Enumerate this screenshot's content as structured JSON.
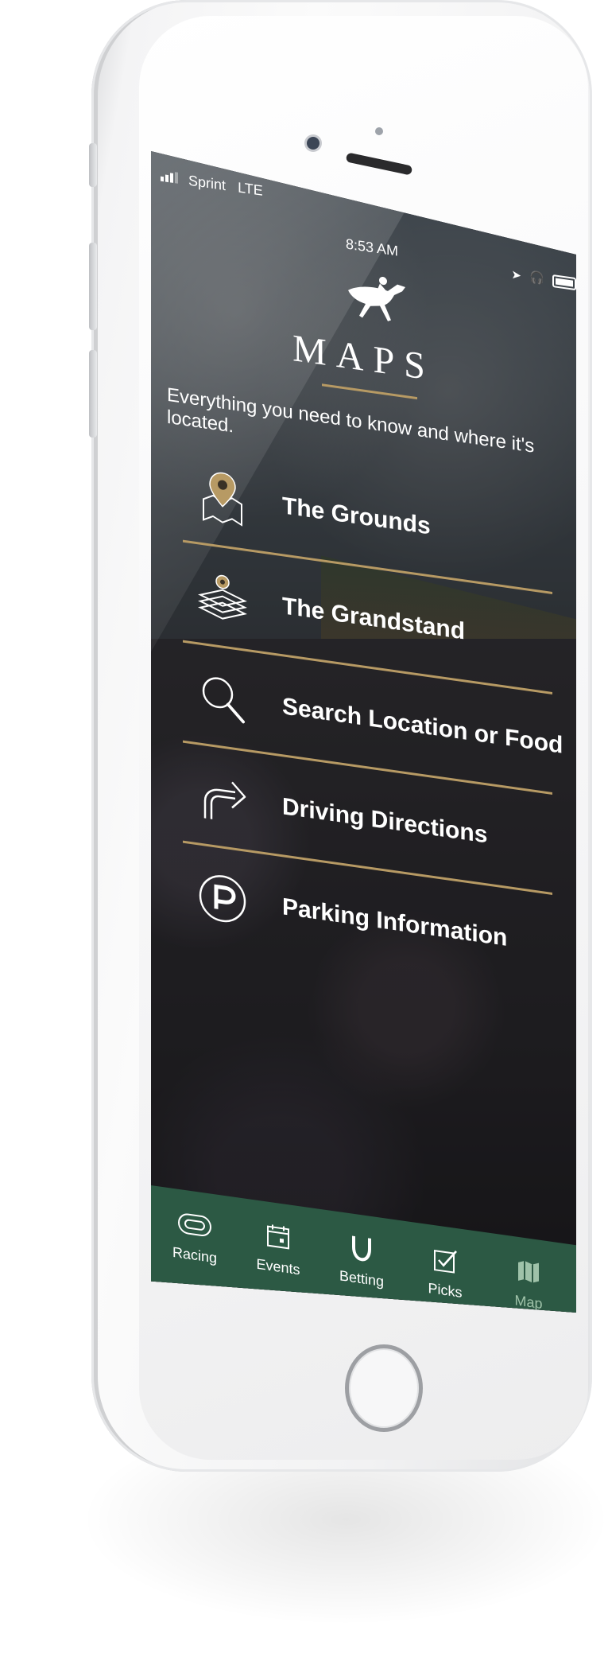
{
  "status_bar": {
    "carrier": "Sprint",
    "network": "LTE",
    "time": "8:53 AM"
  },
  "header": {
    "title": "MAPS",
    "subtitle": "Everything you need to know and where it's located."
  },
  "menu": [
    {
      "label": "The Grounds",
      "icon": "map-pin-icon"
    },
    {
      "label": "The Grandstand",
      "icon": "stacked-floors-icon"
    },
    {
      "label": "Search Location or Food",
      "icon": "search-icon"
    },
    {
      "label": "Driving Directions",
      "icon": "turn-arrow-icon"
    },
    {
      "label": "Parking Information",
      "icon": "parking-icon"
    }
  ],
  "tabbar": {
    "items": [
      {
        "label": "Racing",
        "icon": "track-icon",
        "active": false
      },
      {
        "label": "Events",
        "icon": "calendar-icon",
        "active": false
      },
      {
        "label": "Betting",
        "icon": "horseshoe-icon",
        "active": false
      },
      {
        "label": "Picks",
        "icon": "checkbox-icon",
        "active": false
      },
      {
        "label": "Map",
        "icon": "map-icon",
        "active": true
      }
    ]
  },
  "colors": {
    "accent_gold": "#b79a64",
    "tabbar_green": "#2c5944",
    "active_tab": "#9fc2a9"
  }
}
